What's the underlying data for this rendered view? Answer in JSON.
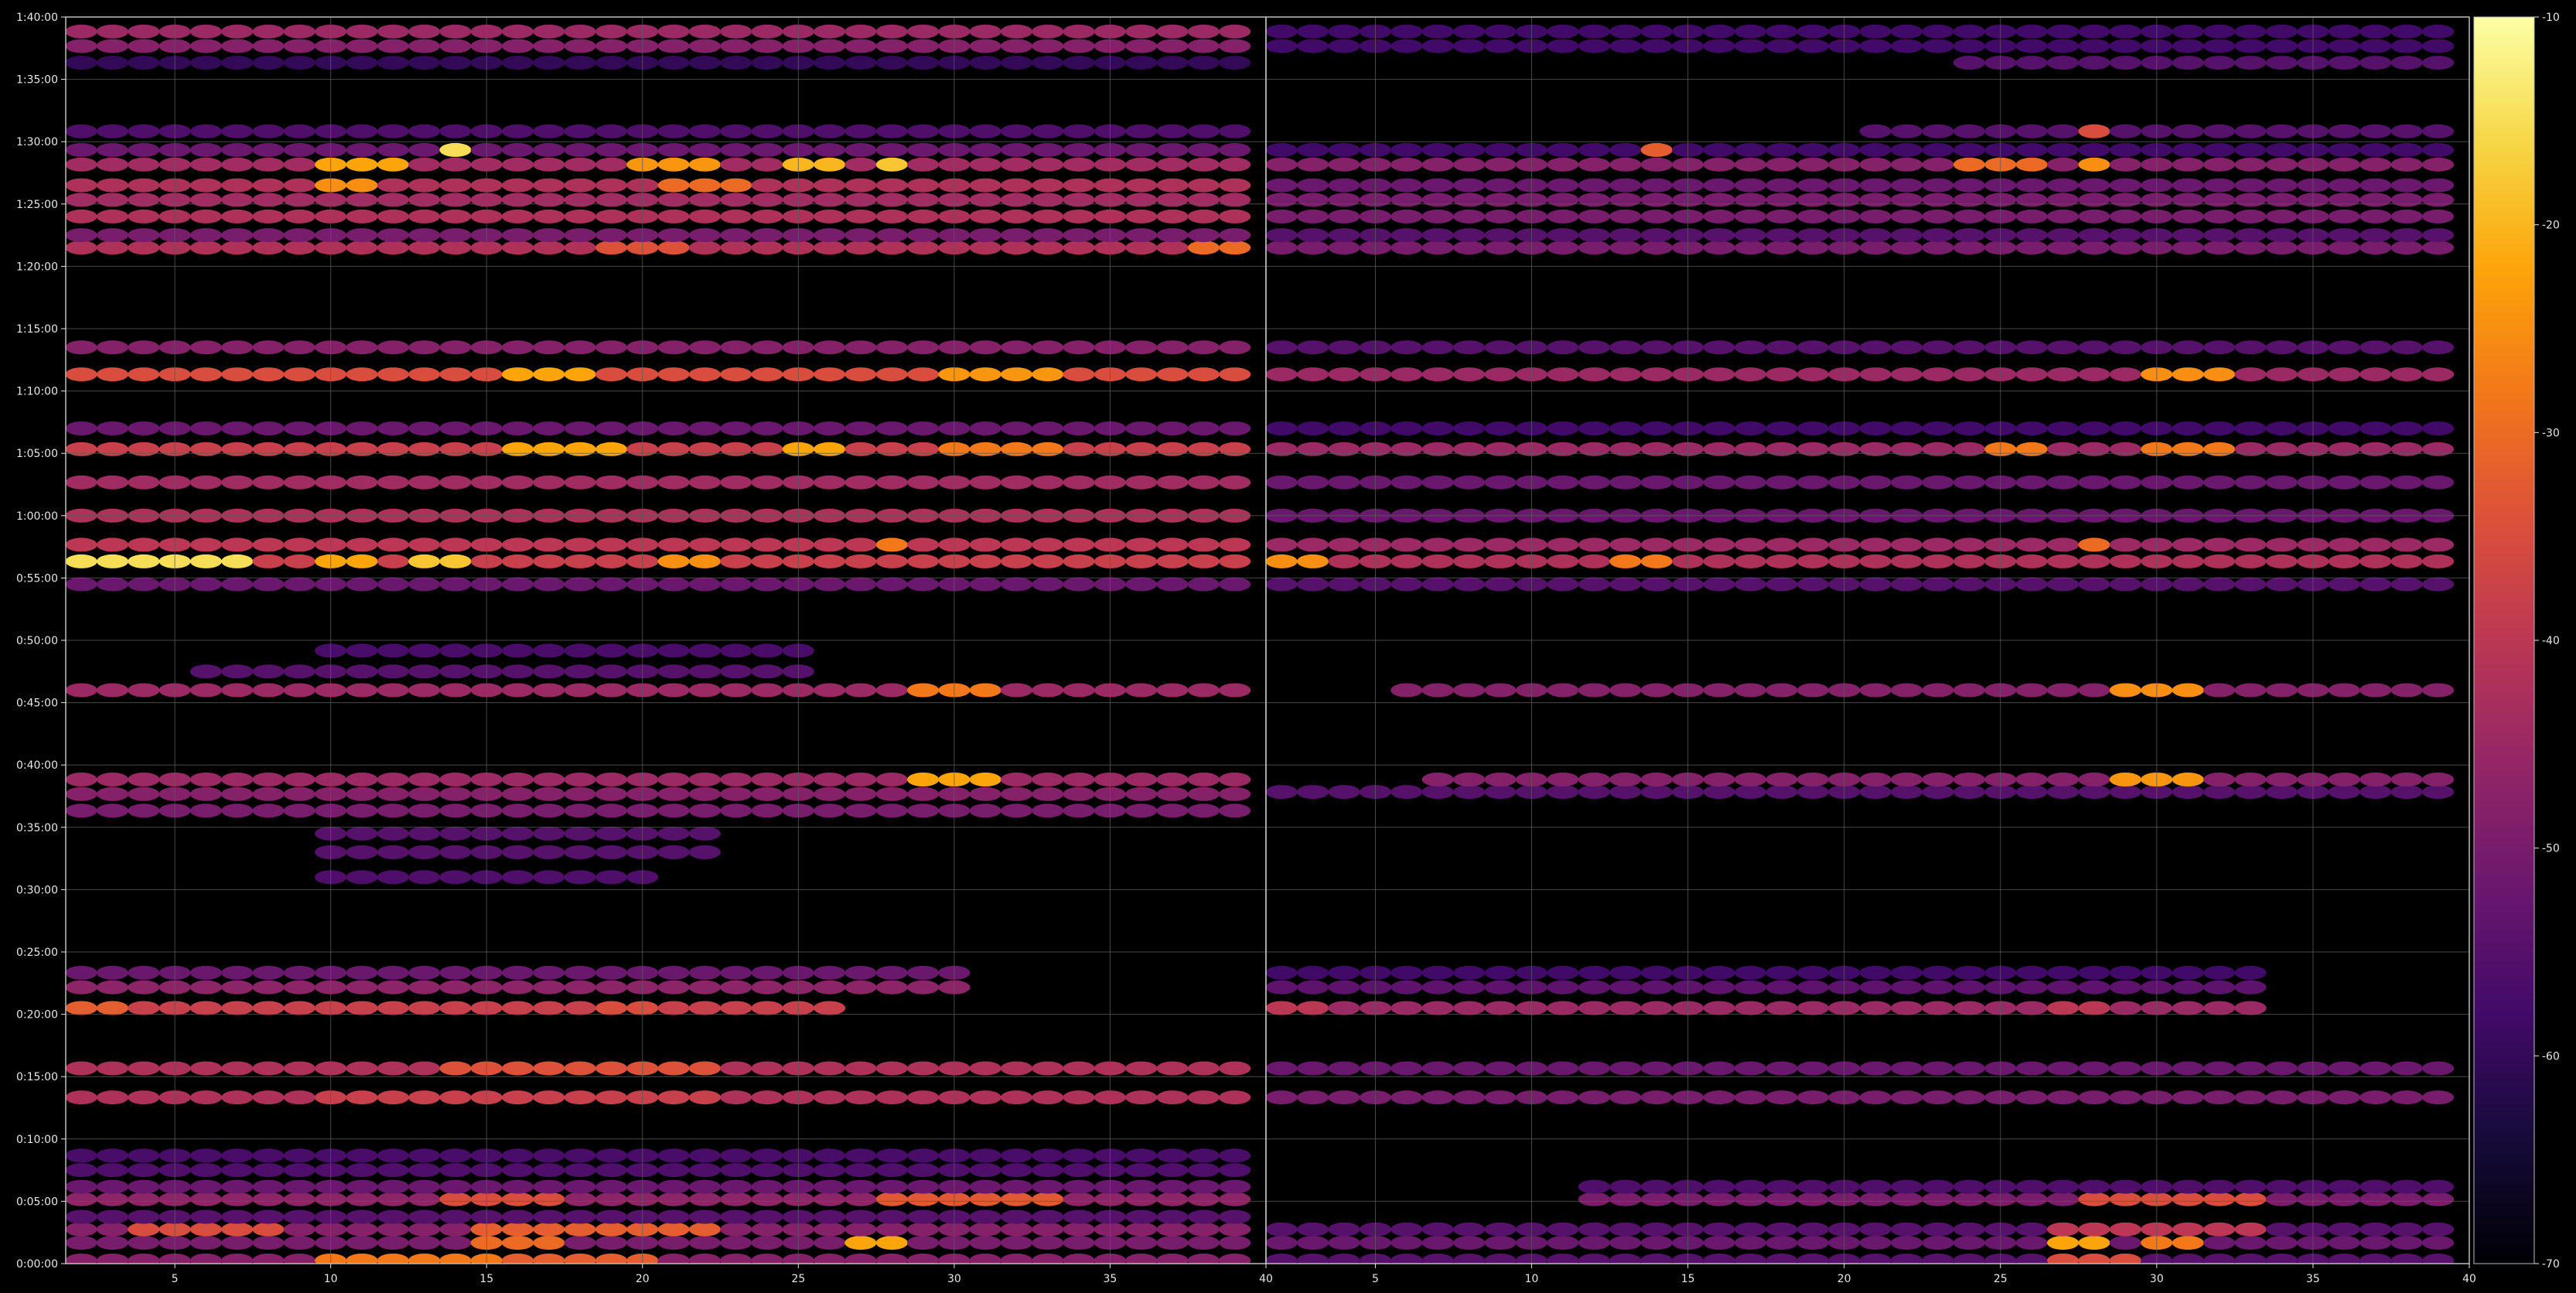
{
  "chart_data": {
    "type": "heatmap",
    "title": "",
    "xlabel": "",
    "ylabel": "",
    "colormap": "inferno",
    "background": "#000000",
    "grid": true,
    "grid_color": "#5a5a5a",
    "color_range": [
      -70,
      -10
    ],
    "colorbar_ticks": [
      "-10",
      "-20",
      "-30",
      "-40",
      "-50",
      "-60",
      "-70"
    ],
    "y_tick_labels": [
      "0:00:00",
      "0:05:00",
      "0:10:00",
      "0:15:00",
      "0:20:00",
      "0:25:00",
      "0:30:00",
      "0:35:00",
      "0:40:00",
      "0:45:00",
      "0:50:00",
      "0:55:00",
      "1:00:00",
      "1:05:00",
      "1:10:00",
      "1:15:00",
      "1:20:00",
      "1:25:00",
      "1:30:00",
      "1:35:00",
      "1:40:00"
    ],
    "ylim_seconds": [
      0,
      6000
    ],
    "panels": [
      {
        "name": "left",
        "xlim": [
          1.5,
          40
        ],
        "x_tick_values": [
          5,
          10,
          15,
          20,
          25,
          30,
          35,
          40
        ],
        "x_tick_labels": [
          "5",
          "10",
          "15",
          "20",
          "25",
          "30",
          "35",
          "40"
        ]
      },
      {
        "name": "right",
        "xlim": [
          1.5,
          40
        ],
        "x_tick_values": [
          5,
          10,
          15,
          20,
          25,
          30,
          35,
          40
        ],
        "x_tick_labels": [
          "5",
          "10",
          "15",
          "20",
          "25",
          "30",
          "35",
          "40"
        ]
      }
    ],
    "x_cells": [
      2,
      3,
      4,
      5,
      6,
      7,
      8,
      9,
      10,
      11,
      12,
      13,
      14,
      15,
      16,
      17,
      18,
      19,
      20,
      21,
      22,
      23,
      24,
      25,
      26,
      27,
      28,
      29,
      30,
      31,
      32,
      33,
      34,
      35,
      36,
      37,
      38,
      39
    ],
    "bands_left": [
      {
        "t": 15,
        "v": -48,
        "x0": 2,
        "x1": 39,
        "strong": [
          [
            10,
            15,
            -28
          ],
          [
            16,
            20,
            -32
          ]
        ]
      },
      {
        "t": 100,
        "v": -50,
        "x0": 2,
        "x1": 39,
        "strong": [
          [
            15,
            17,
            -30
          ],
          [
            27,
            28,
            -22
          ]
        ]
      },
      {
        "t": 165,
        "v": -48,
        "x0": 2,
        "x1": 39,
        "strong": [
          [
            4,
            8,
            -35
          ],
          [
            15,
            22,
            -32
          ]
        ]
      },
      {
        "t": 225,
        "v": -55,
        "x0": 2,
        "x1": 39,
        "strong": []
      },
      {
        "t": 310,
        "v": -47,
        "x0": 2,
        "x1": 39,
        "strong": [
          [
            14,
            17,
            -35
          ],
          [
            28,
            33,
            -33
          ]
        ]
      },
      {
        "t": 370,
        "v": -52,
        "x0": 2,
        "x1": 39,
        "strong": []
      },
      {
        "t": 450,
        "v": -56,
        "x0": 2,
        "x1": 39,
        "strong": []
      },
      {
        "t": 520,
        "v": -57,
        "x0": 2,
        "x1": 39,
        "strong": []
      },
      {
        "t": 800,
        "v": -42,
        "x0": 2,
        "x1": 39,
        "strong": [
          [
            10,
            22,
            -38
          ]
        ]
      },
      {
        "t": 940,
        "v": -42,
        "x0": 2,
        "x1": 39,
        "strong": [
          [
            14,
            22,
            -34
          ]
        ]
      },
      {
        "t": 1230,
        "v": -38,
        "x0": 2,
        "x1": 26,
        "strong": [
          [
            2,
            3,
            -32
          ],
          [
            19,
            20,
            -35
          ]
        ]
      },
      {
        "t": 1330,
        "v": -47,
        "x0": 2,
        "x1": 30,
        "strong": []
      },
      {
        "t": 1400,
        "v": -52,
        "x0": 2,
        "x1": 30,
        "strong": []
      },
      {
        "t": 1860,
        "v": -56,
        "x0": 10,
        "x1": 20,
        "strong": []
      },
      {
        "t": 1980,
        "v": -55,
        "x0": 10,
        "x1": 22,
        "strong": []
      },
      {
        "t": 2070,
        "v": -55,
        "x0": 10,
        "x1": 22,
        "strong": []
      },
      {
        "t": 2180,
        "v": -50,
        "x0": 2,
        "x1": 39,
        "strong": []
      },
      {
        "t": 2260,
        "v": -48,
        "x0": 2,
        "x1": 39,
        "strong": []
      },
      {
        "t": 2330,
        "v": -45,
        "x0": 2,
        "x1": 39,
        "strong": [
          [
            29,
            31,
            -22
          ]
        ]
      },
      {
        "t": 2760,
        "v": -45,
        "x0": 2,
        "x1": 39,
        "strong": [
          [
            29,
            31,
            -28
          ]
        ]
      },
      {
        "t": 2850,
        "v": -55,
        "x0": 6,
        "x1": 25,
        "strong": []
      },
      {
        "t": 2950,
        "v": -57,
        "x0": 10,
        "x1": 25,
        "strong": []
      },
      {
        "t": 3270,
        "v": -52,
        "x0": 2,
        "x1": 39,
        "strong": []
      },
      {
        "t": 3380,
        "v": -38,
        "x0": 2,
        "x1": 39,
        "strong": [
          [
            2,
            7,
            -15
          ],
          [
            10,
            11,
            -22
          ],
          [
            13,
            14,
            -18
          ],
          [
            21,
            22,
            -25
          ]
        ]
      },
      {
        "t": 3460,
        "v": -40,
        "x0": 2,
        "x1": 39,
        "strong": [
          [
            28,
            28,
            -28
          ]
        ]
      },
      {
        "t": 3600,
        "v": -42,
        "x0": 2,
        "x1": 39,
        "strong": []
      },
      {
        "t": 3760,
        "v": -44,
        "x0": 2,
        "x1": 39,
        "strong": []
      },
      {
        "t": 3920,
        "v": -38,
        "x0": 2,
        "x1": 39,
        "strong": [
          [
            16,
            19,
            -22
          ],
          [
            25,
            26,
            -22
          ],
          [
            30,
            33,
            -28
          ]
        ]
      },
      {
        "t": 4020,
        "v": -52,
        "x0": 2,
        "x1": 39,
        "strong": []
      },
      {
        "t": 4280,
        "v": -35,
        "x0": 2,
        "x1": 39,
        "strong": [
          [
            16,
            18,
            -22
          ],
          [
            30,
            33,
            -24
          ]
        ]
      },
      {
        "t": 4410,
        "v": -48,
        "x0": 2,
        "x1": 39,
        "strong": []
      },
      {
        "t": 4890,
        "v": -42,
        "x0": 2,
        "x1": 39,
        "strong": [
          [
            19,
            21,
            -34
          ],
          [
            38,
            39,
            -30
          ]
        ]
      },
      {
        "t": 4950,
        "v": -50,
        "x0": 2,
        "x1": 39,
        "strong": []
      },
      {
        "t": 5040,
        "v": -42,
        "x0": 2,
        "x1": 39,
        "strong": []
      },
      {
        "t": 5120,
        "v": -44,
        "x0": 2,
        "x1": 39,
        "strong": []
      },
      {
        "t": 5190,
        "v": -42,
        "x0": 2,
        "x1": 39,
        "strong": [
          [
            10,
            11,
            -25
          ],
          [
            21,
            23,
            -30
          ]
        ]
      },
      {
        "t": 5290,
        "v": -44,
        "x0": 2,
        "x1": 39,
        "strong": [
          [
            10,
            12,
            -22
          ],
          [
            20,
            22,
            -24
          ],
          [
            25,
            26,
            -20
          ],
          [
            28,
            28,
            -18
          ]
        ]
      },
      {
        "t": 5360,
        "v": -52,
        "x0": 2,
        "x1": 39,
        "strong": [
          [
            14,
            14,
            -15
          ]
        ]
      },
      {
        "t": 5450,
        "v": -56,
        "x0": 2,
        "x1": 39,
        "strong": []
      },
      {
        "t": 5780,
        "v": -60,
        "x0": 2,
        "x1": 39,
        "strong": []
      },
      {
        "t": 5860,
        "v": -48,
        "x0": 2,
        "x1": 39,
        "strong": []
      },
      {
        "t": 5930,
        "v": -45,
        "x0": 2,
        "x1": 39,
        "strong": []
      }
    ],
    "bands_right": [
      {
        "t": 15,
        "v": -55,
        "x0": 2,
        "x1": 39,
        "strong": [
          [
            27,
            29,
            -35
          ]
        ]
      },
      {
        "t": 100,
        "v": -52,
        "x0": 2,
        "x1": 39,
        "strong": [
          [
            27,
            28,
            -22
          ],
          [
            30,
            31,
            -28
          ]
        ]
      },
      {
        "t": 165,
        "v": -55,
        "x0": 2,
        "x1": 39,
        "strong": [
          [
            27,
            33,
            -40
          ]
        ]
      },
      {
        "t": 310,
        "v": -50,
        "x0": 12,
        "x1": 39,
        "strong": [
          [
            28,
            33,
            -35
          ]
        ]
      },
      {
        "t": 370,
        "v": -56,
        "x0": 12,
        "x1": 39,
        "strong": []
      },
      {
        "t": 800,
        "v": -50,
        "x0": 2,
        "x1": 39,
        "strong": []
      },
      {
        "t": 940,
        "v": -52,
        "x0": 2,
        "x1": 39,
        "strong": []
      },
      {
        "t": 1230,
        "v": -45,
        "x0": 2,
        "x1": 33,
        "strong": [
          [
            2,
            3,
            -40
          ],
          [
            27,
            28,
            -40
          ]
        ]
      },
      {
        "t": 1330,
        "v": -54,
        "x0": 2,
        "x1": 33,
        "strong": []
      },
      {
        "t": 1400,
        "v": -58,
        "x0": 2,
        "x1": 33,
        "strong": []
      },
      {
        "t": 2270,
        "v": -55,
        "x0": 2,
        "x1": 39,
        "strong": []
      },
      {
        "t": 2330,
        "v": -48,
        "x0": 7,
        "x1": 39,
        "strong": [
          [
            29,
            31,
            -24
          ]
        ]
      },
      {
        "t": 2760,
        "v": -48,
        "x0": 6,
        "x1": 39,
        "strong": [
          [
            29,
            31,
            -25
          ]
        ]
      },
      {
        "t": 3270,
        "v": -55,
        "x0": 2,
        "x1": 39,
        "strong": []
      },
      {
        "t": 3380,
        "v": -42,
        "x0": 2,
        "x1": 39,
        "strong": [
          [
            2,
            3,
            -25
          ],
          [
            13,
            14,
            -28
          ]
        ]
      },
      {
        "t": 3460,
        "v": -45,
        "x0": 2,
        "x1": 39,
        "strong": [
          [
            28,
            28,
            -30
          ]
        ]
      },
      {
        "t": 3600,
        "v": -52,
        "x0": 2,
        "x1": 39,
        "strong": []
      },
      {
        "t": 3760,
        "v": -52,
        "x0": 2,
        "x1": 39,
        "strong": []
      },
      {
        "t": 3920,
        "v": -45,
        "x0": 2,
        "x1": 39,
        "strong": [
          [
            25,
            26,
            -28
          ],
          [
            30,
            32,
            -28
          ]
        ]
      },
      {
        "t": 4020,
        "v": -58,
        "x0": 2,
        "x1": 39,
        "strong": []
      },
      {
        "t": 4280,
        "v": -45,
        "x0": 2,
        "x1": 39,
        "strong": [
          [
            30,
            32,
            -25
          ]
        ]
      },
      {
        "t": 4410,
        "v": -55,
        "x0": 2,
        "x1": 39,
        "strong": []
      },
      {
        "t": 4890,
        "v": -50,
        "x0": 2,
        "x1": 39,
        "strong": []
      },
      {
        "t": 4950,
        "v": -55,
        "x0": 2,
        "x1": 39,
        "strong": []
      },
      {
        "t": 5040,
        "v": -50,
        "x0": 2,
        "x1": 39,
        "strong": []
      },
      {
        "t": 5120,
        "v": -50,
        "x0": 2,
        "x1": 39,
        "strong": []
      },
      {
        "t": 5190,
        "v": -52,
        "x0": 2,
        "x1": 39,
        "strong": []
      },
      {
        "t": 5290,
        "v": -48,
        "x0": 2,
        "x1": 39,
        "strong": [
          [
            24,
            26,
            -30
          ],
          [
            28,
            28,
            -25
          ]
        ]
      },
      {
        "t": 5360,
        "v": -58,
        "x0": 2,
        "x1": 39,
        "strong": [
          [
            14,
            14,
            -32
          ]
        ]
      },
      {
        "t": 5450,
        "v": -55,
        "x0": 21,
        "x1": 39,
        "strong": [
          [
            28,
            28,
            -35
          ]
        ]
      },
      {
        "t": 5780,
        "v": -55,
        "x0": 24,
        "x1": 39,
        "strong": []
      },
      {
        "t": 5860,
        "v": -58,
        "x0": 2,
        "x1": 39,
        "strong": []
      },
      {
        "t": 5930,
        "v": -58,
        "x0": 2,
        "x1": 39,
        "strong": []
      }
    ]
  }
}
